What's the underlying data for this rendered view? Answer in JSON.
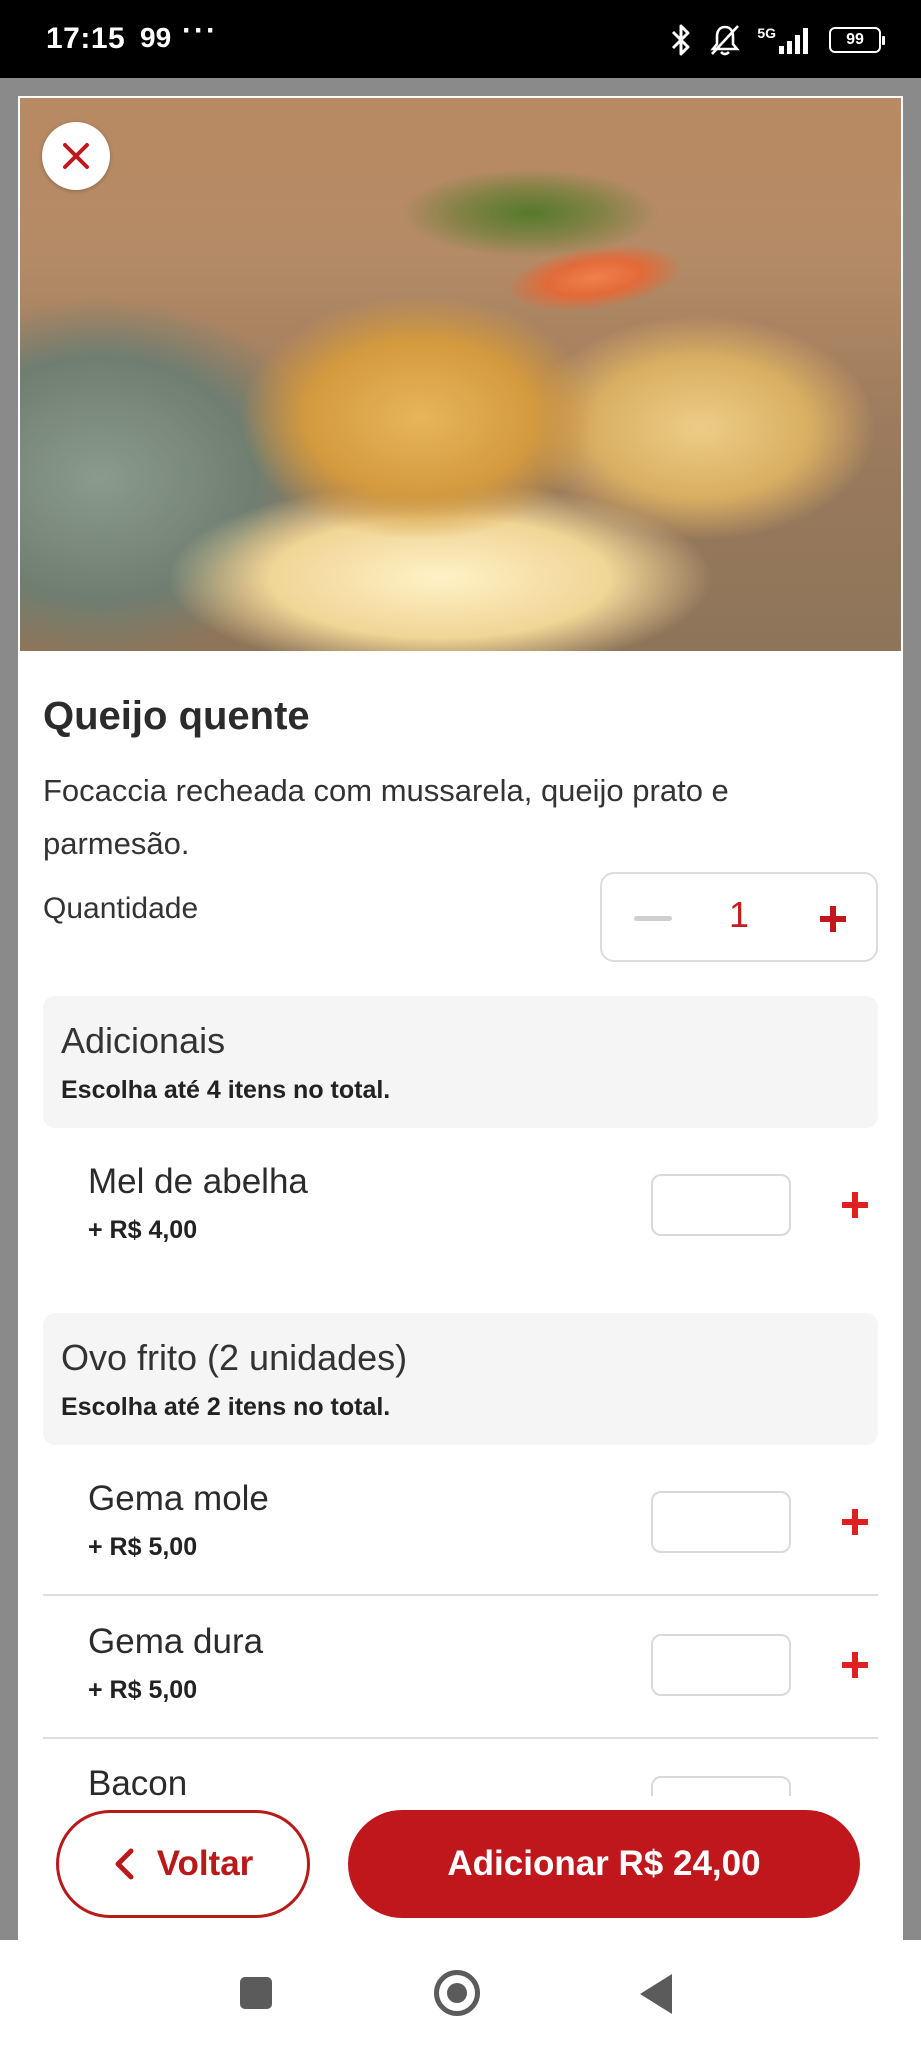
{
  "status_bar": {
    "time": "17:15",
    "notif_count": "99",
    "more": "···",
    "network": "5G",
    "battery": "99"
  },
  "product": {
    "image_alt": "Queijo quente photo",
    "title": "Queijo quente",
    "description": "Focaccia recheada com mussarela, queijo prato e parmesão.",
    "quantity_label": "Quantidade",
    "quantity": "1"
  },
  "groups": [
    {
      "title": "Adicionais",
      "subtitle": "Escolha até 4 itens no total.",
      "items": [
        {
          "name": "Mel de abelha",
          "price": "+ R$ 4,00"
        }
      ]
    },
    {
      "title": "Ovo frito (2 unidades)",
      "subtitle": "Escolha até 2 itens no total.",
      "items": [
        {
          "name": "Gema mole",
          "price": "+ R$ 5,00"
        },
        {
          "name": "Gema dura",
          "price": "+ R$ 5,00"
        },
        {
          "name": "Bacon",
          "price": ""
        }
      ]
    }
  ],
  "footer": {
    "back_label": "Voltar",
    "add_label": "Adicionar R$ 24,00"
  },
  "colors": {
    "accent": "#c0171c",
    "group_bg": "#f5f5f5"
  }
}
